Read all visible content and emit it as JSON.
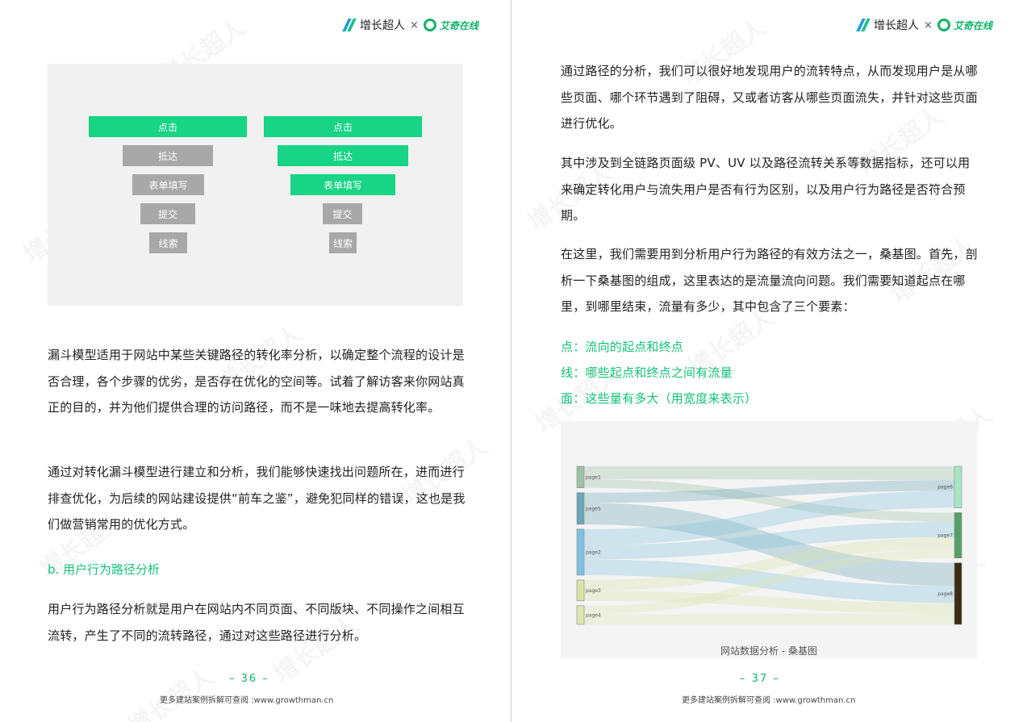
{
  "header": {
    "brand_main": "增长超人",
    "brand_separator": "×",
    "brand_partner": "艾奇在线"
  },
  "watermark": "增长超人",
  "left": {
    "funnel_left": [
      "点击",
      "抵达",
      "表单填写",
      "提交",
      "线索"
    ],
    "funnel_right": [
      "点击",
      "抵达",
      "表单填写",
      "提交",
      "线索"
    ],
    "para1": "漏斗模型适用于网站中某些关键路径的转化率分析，以确定整个流程的设计是否合理，各个步骤的优劣，是否存在优化的空间等。试着了解访客来你网站真正的目的，并为他们提供合理的访问路径，而不是一味地去提高转化率。",
    "para2": "通过对转化漏斗模型进行建立和分析，我们能够快速找出问题所在，进而进行排查优化，为后续的网站建设提供“前车之鉴”，避免犯同样的错误，这也是我们做营销常用的优化方式。",
    "section_heading": "b. 用户行为路径分析",
    "para3": "用户行为路径分析就是用户在网站内不同页面、不同版块、不同操作之间相互流转，产生了不同的流转路径，通过对这些路径进行分析。",
    "page_number": "–   36   –",
    "footer": "更多建站案例拆解可查阅 :www.growthman.cn"
  },
  "right": {
    "para1": "通过路径的分析，我们可以很好地发现用户的流转特点，从而发现用户是从哪些页面、哪个环节遇到了阻碍，又或者访客从哪些页面流失，并针对这些页面进行优化。",
    "para2": "其中涉及到全链路页面级 PV、UV 以及路径流转关系等数据指标，还可以用来确定转化用户与流失用户是否有行为区别，以及用户行为路径是否符合预期。",
    "para3": "在这里，我们需要用到分析用户行为路径的有效方法之一，桑基图。首先，剖析一下桑基图的组成，这里表达的是流量流向问题。我们需要知道起点在哪里，到哪里结束，流量有多少，其中包含了三个要素：",
    "points": [
      "点：流向的起点和终点",
      "线：哪些起点和终点之间有流量",
      "面：这些量有多大（用宽度来表示）"
    ],
    "sankey_caption": "网站数据分析 - 桑基图",
    "page_number": "–   37   –",
    "footer": "更多建站案例拆解可查阅 :www.growthman.cn"
  },
  "chart_data": {
    "type": "sankey",
    "title": "网站数据分析 - 桑基图",
    "sources": [
      {
        "name": "page1",
        "color": "#9dbfa6"
      },
      {
        "name": "page5",
        "color": "#6aa6b6"
      },
      {
        "name": "page2",
        "color": "#7ec0de"
      },
      {
        "name": "page3",
        "color": "#d7e3a6"
      },
      {
        "name": "page4",
        "color": "#dde6b2"
      }
    ],
    "targets": [
      {
        "name": "page6",
        "color": "#a7e6c3"
      },
      {
        "name": "page7",
        "color": "#54a069"
      },
      {
        "name": "page8",
        "color": "#3b2c12"
      }
    ],
    "links": [
      {
        "source": "page1",
        "target": "page6",
        "value": 18
      },
      {
        "source": "page1",
        "target": "page7",
        "value": 12
      },
      {
        "source": "page5",
        "target": "page6",
        "value": 14
      },
      {
        "source": "page5",
        "target": "page8",
        "value": 30
      },
      {
        "source": "page2",
        "target": "page6",
        "value": 22
      },
      {
        "source": "page2",
        "target": "page7",
        "value": 20
      },
      {
        "source": "page2",
        "target": "page8",
        "value": 22
      },
      {
        "source": "page3",
        "target": "page7",
        "value": 15
      },
      {
        "source": "page3",
        "target": "page8",
        "value": 14
      },
      {
        "source": "page4",
        "target": "page7",
        "value": 12
      },
      {
        "source": "page4",
        "target": "page8",
        "value": 14
      }
    ]
  }
}
